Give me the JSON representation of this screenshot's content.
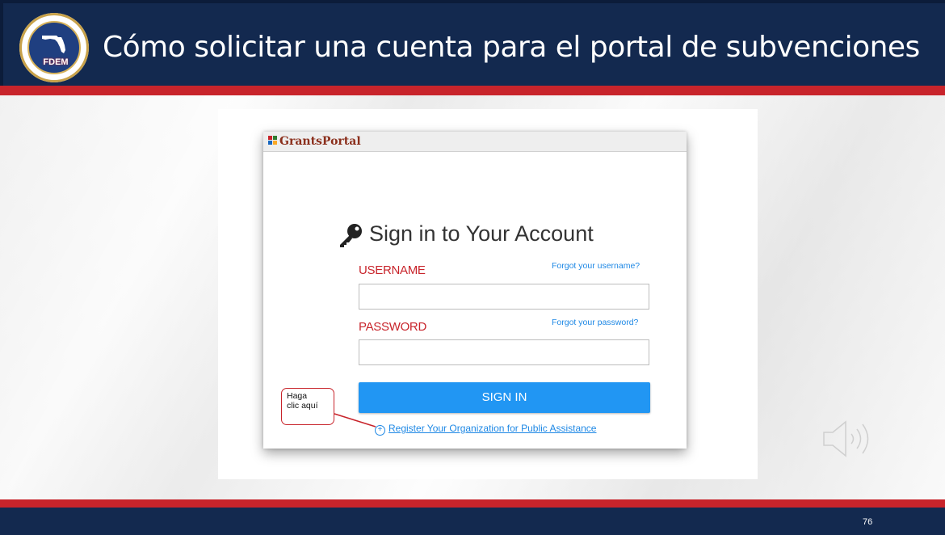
{
  "slide": {
    "title": "Cómo solicitar una cuenta para el portal de subvenciones",
    "logo_text": "FDEM",
    "page_number": "76"
  },
  "portal": {
    "brand": "GrantsPortal",
    "heading": "Sign in to Your Account",
    "username_label": "USERNAME",
    "forgot_username": "Forgot your username?",
    "password_label": "PASSWORD",
    "forgot_password": "Forgot your password?",
    "signin_button": "SIGN IN",
    "register_link": "Register Your Organization for Public Assistance",
    "username_value": "",
    "password_value": ""
  },
  "callout": {
    "line1": "Haga",
    "line2": "clic aquí"
  },
  "icons": [
    "key-icon",
    "plus-circle-icon",
    "speaker-icon",
    "fdem-logo",
    "grants-portal-logo"
  ],
  "colors": {
    "navy": "#13294f",
    "red": "#c8242b",
    "button_blue": "#2196f3",
    "link_blue": "#1e88e5"
  }
}
